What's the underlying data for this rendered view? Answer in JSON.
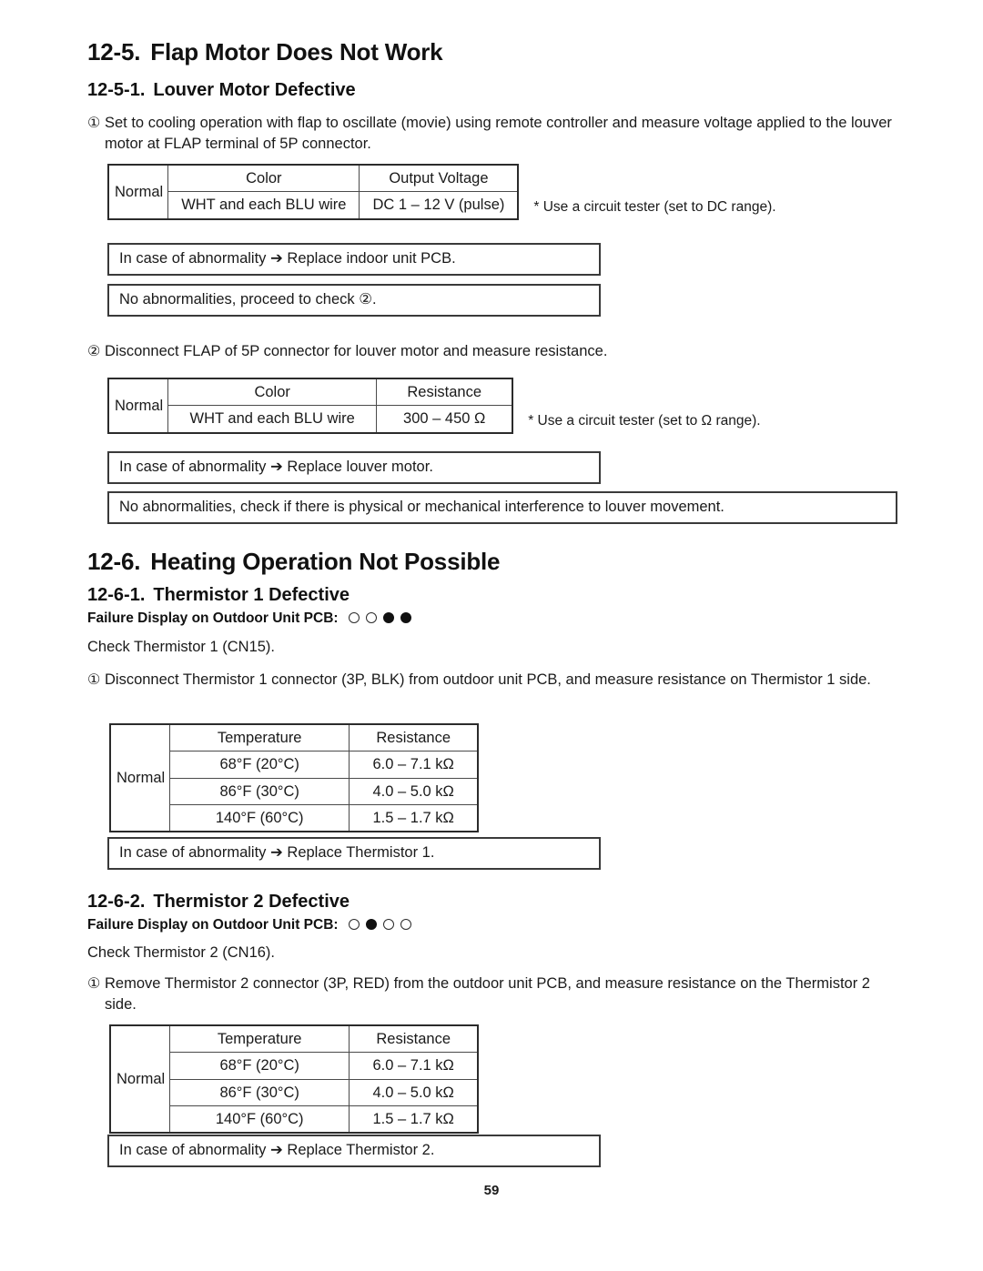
{
  "document": {
    "page_number": "59"
  },
  "sections": [
    {
      "id": "12-5",
      "number": "12-5.",
      "title": "Flap Motor Does Not Work",
      "subsection": {
        "number": "12-5-1.",
        "title": "Louver Motor Defective"
      },
      "step1": {
        "marker": "①",
        "text": "Set to cooling operation with flap to oscillate (movie) using remote controller and measure voltage applied to the louver motor at FLAP terminal of 5P connector."
      },
      "table1": {
        "row_label": "Normal",
        "headers": [
          "Color",
          "Output Voltage"
        ],
        "rows": [
          [
            "WHT and each BLU wire",
            "DC 1 – 12 V (pulse)"
          ]
        ],
        "note": "* Use a circuit tester (set to DC range)."
      },
      "box1": "In case of abnormality ➔ Replace indoor unit PCB.",
      "box2": "No abnormalities, proceed to check ②.",
      "step2": {
        "marker": "②",
        "text": "Disconnect FLAP of 5P connector for louver motor and measure resistance."
      },
      "table2": {
        "row_label": "Normal",
        "headers": [
          "Color",
          "Resistance"
        ],
        "rows": [
          [
            "WHT and each BLU wire",
            "300 – 450 Ω"
          ]
        ],
        "note": "* Use a circuit tester (set to Ω range)."
      },
      "box3": "In case of abnormality ➔ Replace louver motor.",
      "box4": "No abnormalities, check if there is physical or mechanical interference to louver movement."
    },
    {
      "id": "12-6",
      "number": "12-6.",
      "title": "Heating Operation Not Possible",
      "subsection1": {
        "number": "12-6-1.",
        "title": "Thermistor 1 Defective",
        "failure_label": "Failure Display on Outdoor Unit PCB:",
        "failure_dots": [
          "open",
          "open",
          "filled",
          "filled"
        ],
        "check_line": "Check Thermistor 1 (CN15).",
        "step1": {
          "marker": "①",
          "text": "Disconnect Thermistor 1 connector (3P, BLK) from outdoor unit PCB, and measure resistance on Thermistor 1 side."
        },
        "table": {
          "row_label": "Normal",
          "headers": [
            "Temperature",
            "Resistance"
          ],
          "rows": [
            [
              "68°F (20°C)",
              "6.0 – 7.1 kΩ"
            ],
            [
              "86°F (30°C)",
              "4.0 – 5.0 kΩ"
            ],
            [
              "140°F (60°C)",
              "1.5 – 1.7 kΩ"
            ]
          ]
        },
        "box": "In case of abnormality ➔ Replace Thermistor 1."
      },
      "subsection2": {
        "number": "12-6-2.",
        "title": "Thermistor 2 Defective",
        "failure_label": "Failure Display on Outdoor Unit PCB:",
        "failure_dots": [
          "open",
          "filled",
          "open",
          "open"
        ],
        "check_line": "Check Thermistor 2 (CN16).",
        "step1": {
          "marker": "①",
          "text": "Remove Thermistor 2 connector (3P, RED) from the outdoor unit PCB, and measure resistance on the Thermistor 2 side."
        },
        "table": {
          "row_label": "Normal",
          "headers": [
            "Temperature",
            "Resistance"
          ],
          "rows": [
            [
              "68°F (20°C)",
              "6.0 – 7.1 kΩ"
            ],
            [
              "86°F (30°C)",
              "4.0 – 5.0 kΩ"
            ],
            [
              "140°F (60°C)",
              "1.5 – 1.7 kΩ"
            ]
          ]
        },
        "box": "In case of abnormality ➔ Replace Thermistor 2."
      }
    }
  ]
}
